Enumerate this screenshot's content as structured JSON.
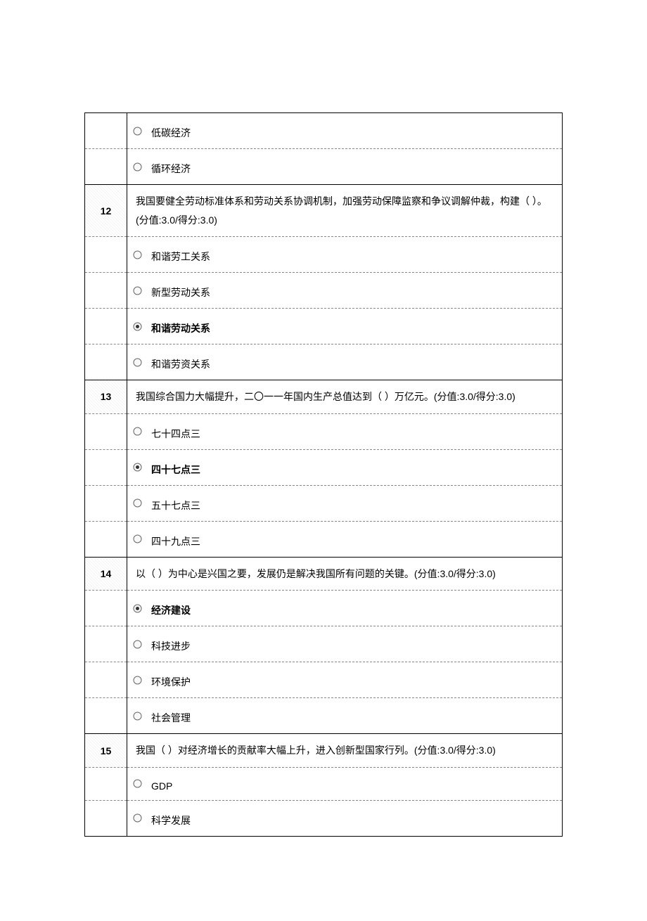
{
  "rows": [
    {
      "type": "option",
      "selected": false,
      "text": "低碳经济",
      "firstRow": true
    },
    {
      "type": "option",
      "selected": false,
      "text": "循环经济"
    },
    {
      "type": "question",
      "num": "12",
      "text": "我国要健全劳动标准体系和劳动关系协调机制，加强劳动保障监察和争议调解仲裁，构建（ ）。(分值:3.0/得分:3.0)"
    },
    {
      "type": "option",
      "selected": false,
      "text": "和谐劳工关系"
    },
    {
      "type": "option",
      "selected": false,
      "text": "新型劳动关系"
    },
    {
      "type": "option",
      "selected": true,
      "text": "和谐劳动关系"
    },
    {
      "type": "option",
      "selected": false,
      "text": "和谐劳资关系"
    },
    {
      "type": "question",
      "num": "13",
      "text": "我国综合国力大幅提升，二〇一一年国内生产总值达到（ ）万亿元。(分值:3.0/得分:3.0)"
    },
    {
      "type": "option",
      "selected": false,
      "text": "七十四点三"
    },
    {
      "type": "option",
      "selected": true,
      "text": "四十七点三"
    },
    {
      "type": "option",
      "selected": false,
      "text": "五十七点三"
    },
    {
      "type": "option",
      "selected": false,
      "text": "四十九点三"
    },
    {
      "type": "question",
      "num": "14",
      "text": "以（ ）为中心是兴国之要，发展仍是解决我国所有问题的关键。(分值:3.0/得分:3.0)"
    },
    {
      "type": "option",
      "selected": true,
      "text": "经济建设"
    },
    {
      "type": "option",
      "selected": false,
      "text": "科技进步"
    },
    {
      "type": "option",
      "selected": false,
      "text": "环境保护"
    },
    {
      "type": "option",
      "selected": false,
      "text": "社会管理"
    },
    {
      "type": "question",
      "num": "15",
      "text": "我国（ ）对经济增长的贡献率大幅上升，进入创新型国家行列。(分值:3.0/得分:3.0)"
    },
    {
      "type": "option",
      "selected": false,
      "text": "GDP"
    },
    {
      "type": "option",
      "selected": false,
      "text": "科学发展"
    }
  ]
}
